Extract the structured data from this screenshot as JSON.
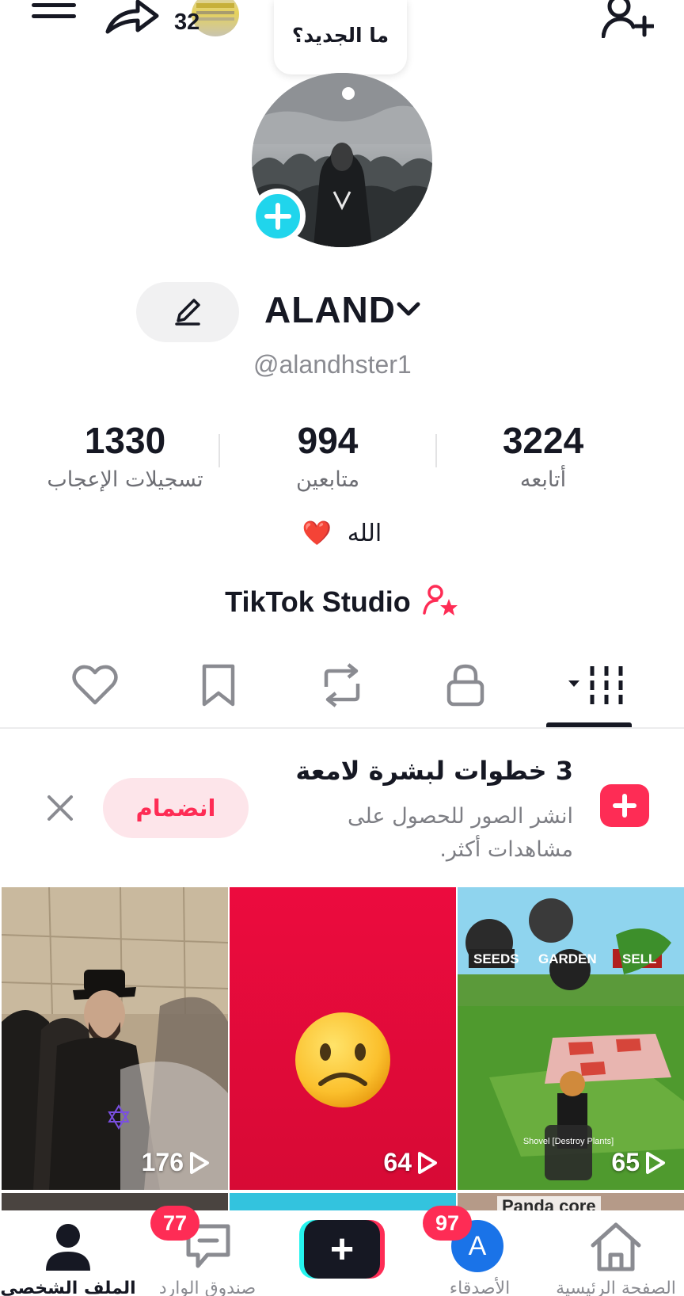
{
  "header": {
    "story_count": "32",
    "whats_new_label": "ما الجديد؟"
  },
  "profile": {
    "username": "ALAND",
    "handle": "@alandhster1",
    "bio_text": "الله",
    "bio_emoji": "❤️",
    "studio_label": "TikTok Studio"
  },
  "stats": [
    {
      "value": "3224",
      "label": "أتابعه"
    },
    {
      "value": "994",
      "label": "متابعين"
    },
    {
      "value": "1330",
      "label": "تسجيلات الإعجاب"
    }
  ],
  "tabs": [
    {
      "name": "videos",
      "icon": "grid-icon",
      "active": true
    },
    {
      "name": "private",
      "icon": "lock-icon",
      "active": false
    },
    {
      "name": "reposts",
      "icon": "repost-icon",
      "active": false
    },
    {
      "name": "favorites",
      "icon": "bookmark-icon",
      "active": false
    },
    {
      "name": "liked",
      "icon": "heart-icon",
      "active": false
    }
  ],
  "promo": {
    "title": "3 خطوات لبشرة لامعة",
    "text": "انشر الصور للحصول على مشاهدات أكثر.",
    "join_label": "انضمام"
  },
  "videos": [
    {
      "views": "65",
      "game_labels": {
        "seeds": "SEEDS",
        "garden": "GARDEN",
        "sell": "SELL",
        "tool": "Shovel [Destroy Plants]"
      }
    },
    {
      "views": "64"
    },
    {
      "views": "176"
    }
  ],
  "next_row_caption": "Panda core",
  "bottom_nav": {
    "home": "الصفحة الرئيسية",
    "friends": "الأصدقاء",
    "friends_badge": "97",
    "friends_avatar_letter": "A",
    "inbox": "صندوق الوارد",
    "inbox_badge": "77",
    "profile": "الملف الشخصي",
    "create_symbol": "+"
  },
  "colors": {
    "brand_pink": "#fe2c55",
    "brand_cyan": "#25f4ee",
    "avatar_add": "#20d5ec",
    "text_primary": "#161823",
    "text_secondary": "#8a8b91"
  }
}
